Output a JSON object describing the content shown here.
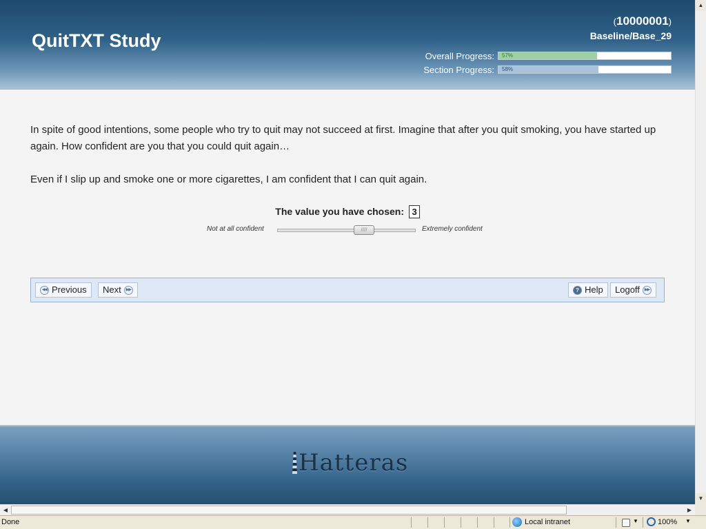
{
  "header": {
    "title": "QuitTXT Study",
    "participant_id": "10000001",
    "paren_open": "(",
    "paren_close": ")",
    "session": "Baseline/Base_29",
    "overall_progress": {
      "label": "Overall Progress:",
      "pct_text": "57%",
      "value": 0.57
    },
    "section_progress": {
      "label": "Section Progress:",
      "pct_text": "58%",
      "value": 0.58
    },
    "colors": {
      "overall_fill": "#9ed1a1",
      "section_fill": "#a8c4dc"
    }
  },
  "question": {
    "intro": "In spite of good intentions, some people who try to quit may not succeed at first. Imagine that after you quit smoking, you have started up again. How confident are you that you could quit again…",
    "statement": "Even if I slip up and smoke one or more cigarettes, I am confident that I can quit again.",
    "chosen_label": "The value you have chosen:",
    "chosen_value": "3",
    "slider": {
      "min_label": "Not at all confident",
      "max_label": "Extremely confident",
      "value": 3,
      "thumb_glyph": "////"
    }
  },
  "nav": {
    "previous": "Previous",
    "next": "Next",
    "help": "Help",
    "logoff": "Logoff",
    "back_glyph": "◀◀",
    "fwd_glyph": "▶▶",
    "help_glyph": "?"
  },
  "footer": {
    "brand": "Hatteras"
  },
  "scrollbars": {
    "up": "▲",
    "down": "▼",
    "left": "◀",
    "right": "▶"
  },
  "statusbar": {
    "status": "Done",
    "zone": "Local intranet",
    "zoom": "100%",
    "dropdown_glyph": "▼"
  }
}
